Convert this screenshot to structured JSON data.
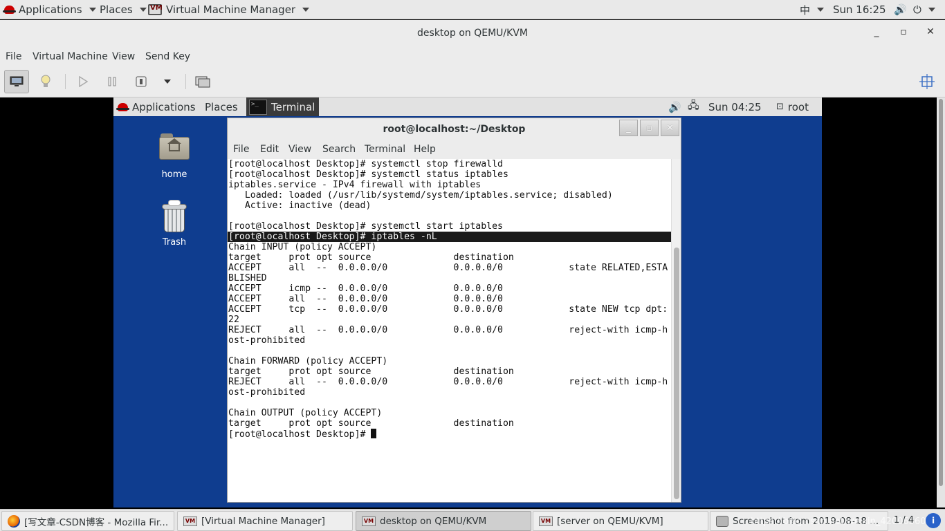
{
  "host_topbar": {
    "applications": "Applications",
    "places": "Places",
    "app_name": "Virtual Machine Manager",
    "input_method": "中",
    "clock": "Sun 16:25"
  },
  "vm_window": {
    "title": "desktop on QEMU/KVM",
    "menu": [
      "File",
      "Virtual Machine",
      "View",
      "Send Key"
    ]
  },
  "guest": {
    "topbar": {
      "applications": "Applications",
      "places": "Places",
      "terminal": "Terminal",
      "clock": "Sun 04:25",
      "user": "root"
    },
    "desktop_icons": [
      {
        "label": "home"
      },
      {
        "label": "Trash"
      }
    ],
    "terminal": {
      "title": "root@localhost:~/Desktop",
      "menu": [
        "File",
        "Edit",
        "View",
        "Search",
        "Terminal",
        "Help"
      ],
      "lines": [
        "[root@localhost Desktop]# systemctl stop firewalld",
        "[root@localhost Desktop]# systemctl status iptables",
        "iptables.service - IPv4 firewall with iptables",
        "   Loaded: loaded (/usr/lib/systemd/system/iptables.service; disabled)",
        "   Active: inactive (dead)",
        "",
        "[root@localhost Desktop]# systemctl start iptables",
        "[root@localhost Desktop]# iptables -nL",
        "Chain INPUT (policy ACCEPT)",
        "target     prot opt source               destination",
        "ACCEPT     all  --  0.0.0.0/0            0.0.0.0/0            state RELATED,ESTA",
        "BLISHED",
        "ACCEPT     icmp --  0.0.0.0/0            0.0.0.0/0",
        "ACCEPT     all  --  0.0.0.0/0            0.0.0.0/0",
        "ACCEPT     tcp  --  0.0.0.0/0            0.0.0.0/0            state NEW tcp dpt:",
        "22",
        "REJECT     all  --  0.0.0.0/0            0.0.0.0/0            reject-with icmp-h",
        "ost-prohibited",
        "",
        "Chain FORWARD (policy ACCEPT)",
        "target     prot opt source               destination",
        "REJECT     all  --  0.0.0.0/0            0.0.0.0/0            reject-with icmp-h",
        "ost-prohibited",
        "",
        "Chain OUTPUT (policy ACCEPT)",
        "target     prot opt source               destination"
      ],
      "prompt": "[root@localhost Desktop]# "
    }
  },
  "taskbar": {
    "tasks": [
      "[写文章-CSDN博客 - Mozilla Fir...",
      "[Virtual Machine Manager]",
      "desktop on QEMU/KVM",
      "[server on QEMU/KVM]",
      "Screenshot from 2019-08-18 ..."
    ],
    "pager": "1 / 4",
    "watermark": "https://blog.csdn.net/weixin_42006560"
  }
}
